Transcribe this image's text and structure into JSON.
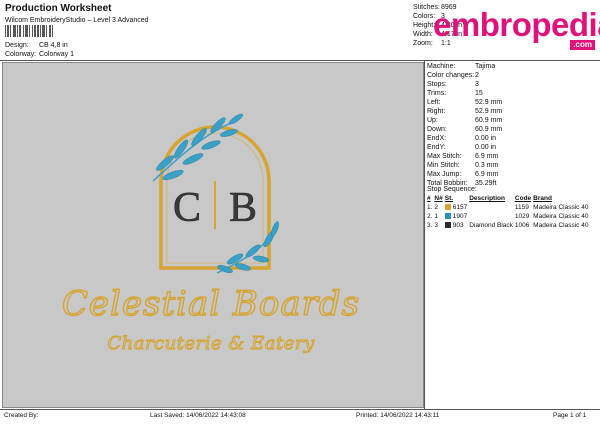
{
  "header": {
    "title": "Production Worksheet",
    "subtitle": "Wilcom EmbroideryStudio – Level 3 Advanced",
    "design_label": "Design:",
    "design_value": "CB 4,8 in",
    "colorway_label": "Colorway:",
    "colorway_value": "Colorway 1"
  },
  "stats": [
    {
      "label": "Stitches:",
      "value": "8969"
    },
    {
      "label": "Colors:",
      "value": "3"
    },
    {
      "label": "Height:",
      "value": "4.80 in"
    },
    {
      "label": "Width:",
      "value": "4.17 in"
    },
    {
      "label": "Zoom:",
      "value": "1:1"
    }
  ],
  "logo": {
    "word": "embropedia",
    "dotcom": ".com",
    "color": "#e0117b"
  },
  "machine": [
    {
      "label": "Machine:",
      "value": "Tajima"
    },
    {
      "label": "Color changes:",
      "value": "2"
    },
    {
      "label": "Stops:",
      "value": "3"
    },
    {
      "label": "Trims:",
      "value": "15"
    },
    {
      "label": "Left:",
      "value": "52.9 mm"
    },
    {
      "label": "Right:",
      "value": "52.9 mm"
    },
    {
      "label": "Up:",
      "value": "60.9 mm"
    },
    {
      "label": "Down:",
      "value": "60.9 mm"
    },
    {
      "label": "EndX:",
      "value": "0.00 in"
    },
    {
      "label": "EndY:",
      "value": "0.00 in"
    },
    {
      "label": "Max Stitch:",
      "value": "6.9 mm"
    },
    {
      "label": "Min Stitch:",
      "value": "0.3 mm"
    },
    {
      "label": "Max Jump:",
      "value": "6.9 mm"
    },
    {
      "label": "Total Bobbin:",
      "value": "35.29ft"
    }
  ],
  "stop_sequence": {
    "title": "Stop Sequence:",
    "headers": [
      "#",
      "N#",
      "",
      "St.",
      "Description",
      "Code",
      "Brand"
    ],
    "rows": [
      {
        "num": "1.",
        "n": "2",
        "color": "#d6a42f",
        "st": "6157",
        "desc": "",
        "code": "1159",
        "brand": "Madeira Classic 40"
      },
      {
        "num": "2.",
        "n": "1",
        "color": "#2e8fbf",
        "st": "1907",
        "desc": "",
        "code": "1029",
        "brand": "Madeira Classic 40"
      },
      {
        "num": "3.",
        "n": "3",
        "color": "#2a2a2a",
        "st": "903",
        "desc": "Diamond Black",
        "code": "1006",
        "brand": "Madeira Classic 40"
      }
    ]
  },
  "design": {
    "monogram_left": "C",
    "monogram_right": "B",
    "name": "Celestial Boards",
    "tagline": "Charcuterie & Eatery",
    "gold": "#d6a42f",
    "blue": "#3aa0c8",
    "black": "#3a3a3a",
    "background": "#c8c8c8"
  },
  "footer": {
    "created": "Created By:",
    "saved": "Last Saved: 14/06/2022 14:43:08",
    "printed": "Printed: 14/06/2022 14:43:11",
    "page": "Page 1 of 1"
  }
}
